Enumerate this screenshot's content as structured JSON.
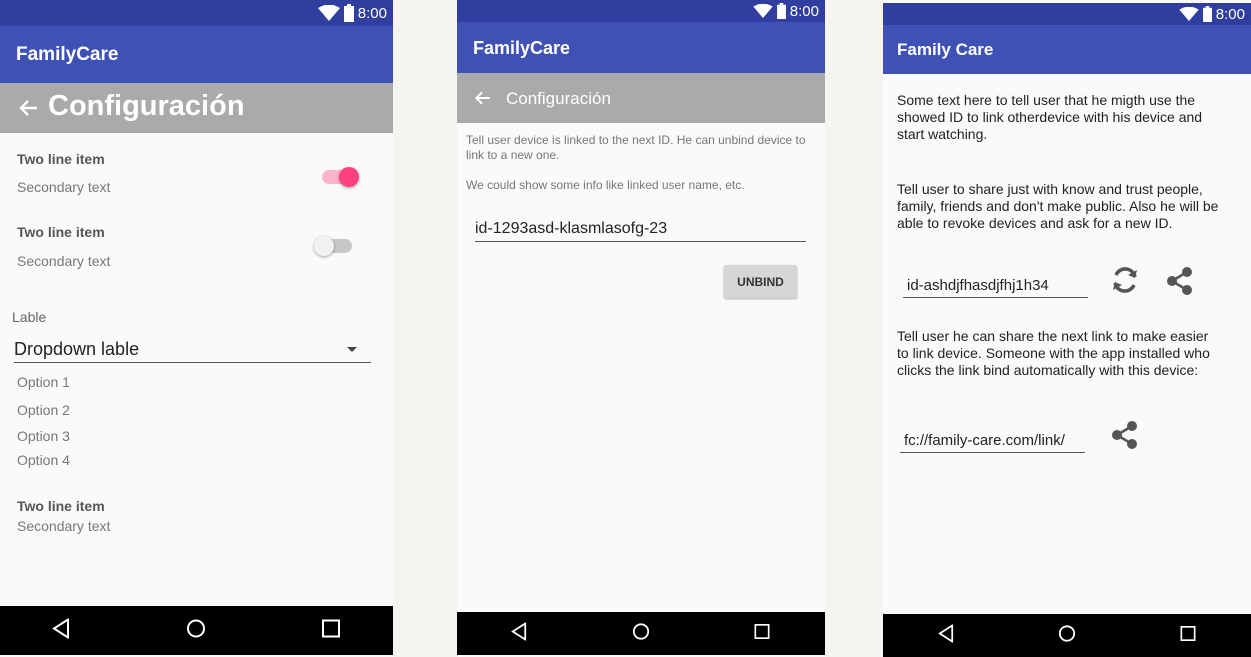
{
  "status": {
    "time": "8:00"
  },
  "screen1": {
    "app_title": "FamilyCare",
    "sub_title": "Configuración",
    "items": [
      {
        "title": "Two line item",
        "secondary": "Secondary text",
        "toggle_on": true
      },
      {
        "title": "Two line item",
        "secondary": "Secondary text",
        "toggle_on": false
      }
    ],
    "dropdown": {
      "label": "Lable",
      "value": "Dropdown lable",
      "options": [
        "Option 1",
        "Option 2",
        "Option 3",
        "Option 4"
      ]
    },
    "last_item": {
      "title": "Two line item",
      "secondary": "Secondary text"
    }
  },
  "screen2": {
    "app_title": "FamilyCare",
    "sub_title": "Configuración",
    "info_text": "Tell user device is linked to the next ID. He can unbind device to link to a new one.",
    "extra_text": "We could show some info like linked user name, etc.",
    "device_id": "id-1293asd-klasmlasofg-23",
    "unbind_label": "UNBIND"
  },
  "screen3": {
    "app_title": "Family Care",
    "intro_text": "Some text here to tell user that he migth use the showed ID to link otherdevice with his device and start watching.",
    "share_text": "Tell user to share just with know and trust people, family, friends and don't make public. Also he will be able to revoke devices and ask for a new ID.",
    "device_id": "id-ashdjfhasdjfhj1h34",
    "link_text": "Tell user he can share the next link to make easier to link device. Someone with the app installed who clicks the link bind automatically with this device:",
    "link_value": "fc://family-care.com/link/"
  },
  "colors": {
    "status_bar": "#303f9f",
    "app_bar": "#3f51b5",
    "sub_bar": "#aaaaaa",
    "accent": "#ff4081",
    "nav_bar": "#000000"
  },
  "icons": [
    "wifi-icon",
    "battery-icon",
    "back-arrow-icon",
    "refresh-icon",
    "share-icon",
    "nav-back-icon",
    "nav-home-icon",
    "nav-recents-icon"
  ]
}
